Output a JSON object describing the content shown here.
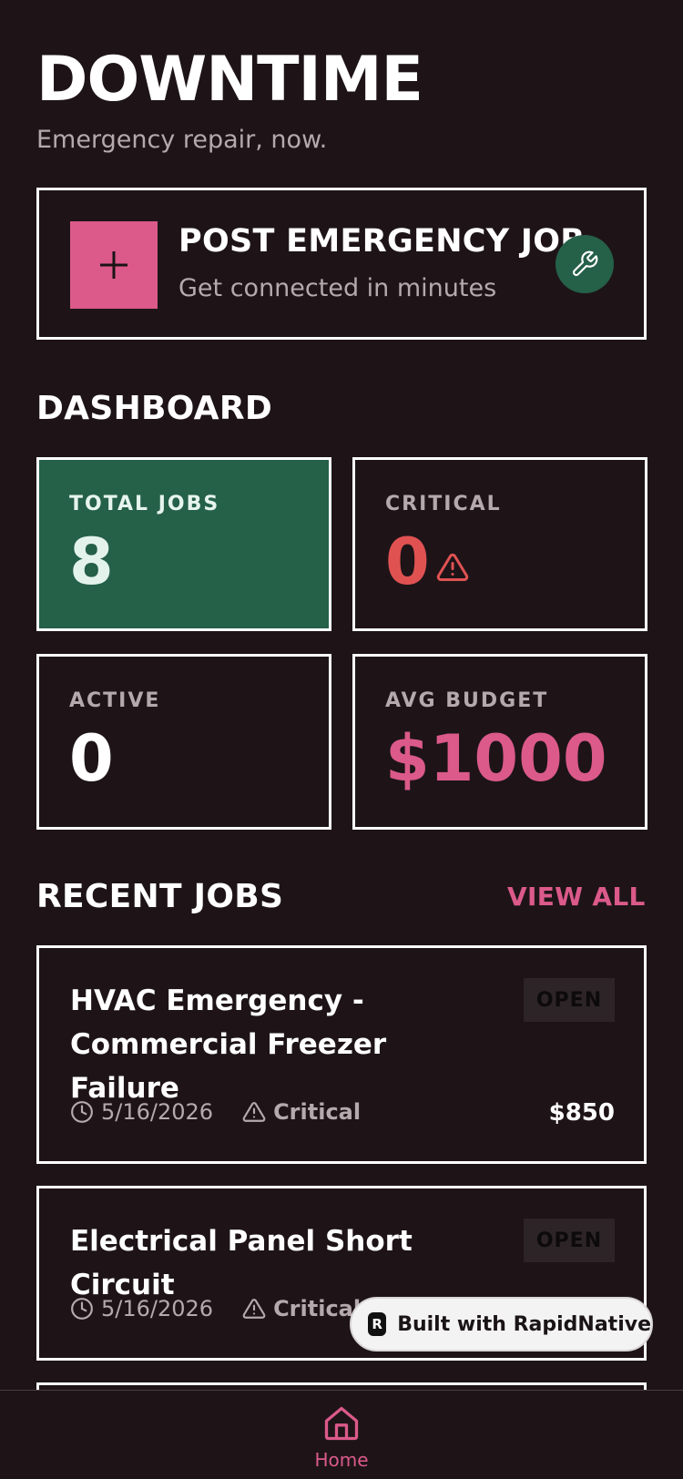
{
  "header": {
    "title": "DOWNTIME",
    "subtitle": "Emergency repair, now."
  },
  "post_job": {
    "title": "POST EMERGENCY JOB",
    "subtitle": "Get connected in minutes",
    "plus_icon": "plus-icon",
    "wrench_icon": "wrench-icon"
  },
  "dashboard": {
    "heading": "DASHBOARD",
    "stats": [
      {
        "label": "TOTAL JOBS",
        "value": "8"
      },
      {
        "label": "CRITICAL",
        "value": "0"
      },
      {
        "label": "ACTIVE",
        "value": "0"
      },
      {
        "label": "AVG BUDGET",
        "value": "$1000"
      }
    ]
  },
  "recent": {
    "heading": "RECENT JOBS",
    "view_all": "VIEW ALL",
    "jobs": [
      {
        "title": "HVAC Emergency - Commercial Freezer Failure",
        "status": "OPEN",
        "date": "5/16/2026",
        "severity": "Critical",
        "price": "$850"
      },
      {
        "title": "Electrical Panel Short Circuit",
        "status": "OPEN",
        "date": "5/16/2026",
        "severity": "Critical"
      }
    ]
  },
  "built_with": "Built with RapidNative",
  "tabbar": {
    "home_label": "Home"
  },
  "colors": {
    "background": "#1e1418",
    "accent_pink": "#db5a8a",
    "accent_green": "#256049",
    "critical_red": "#e05252",
    "muted_text": "#b6a9ae"
  }
}
